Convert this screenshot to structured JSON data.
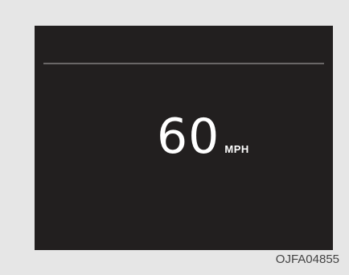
{
  "display": {
    "speed_value": "60",
    "speed_unit": "MPH"
  },
  "figure_code": "OJFA04855"
}
